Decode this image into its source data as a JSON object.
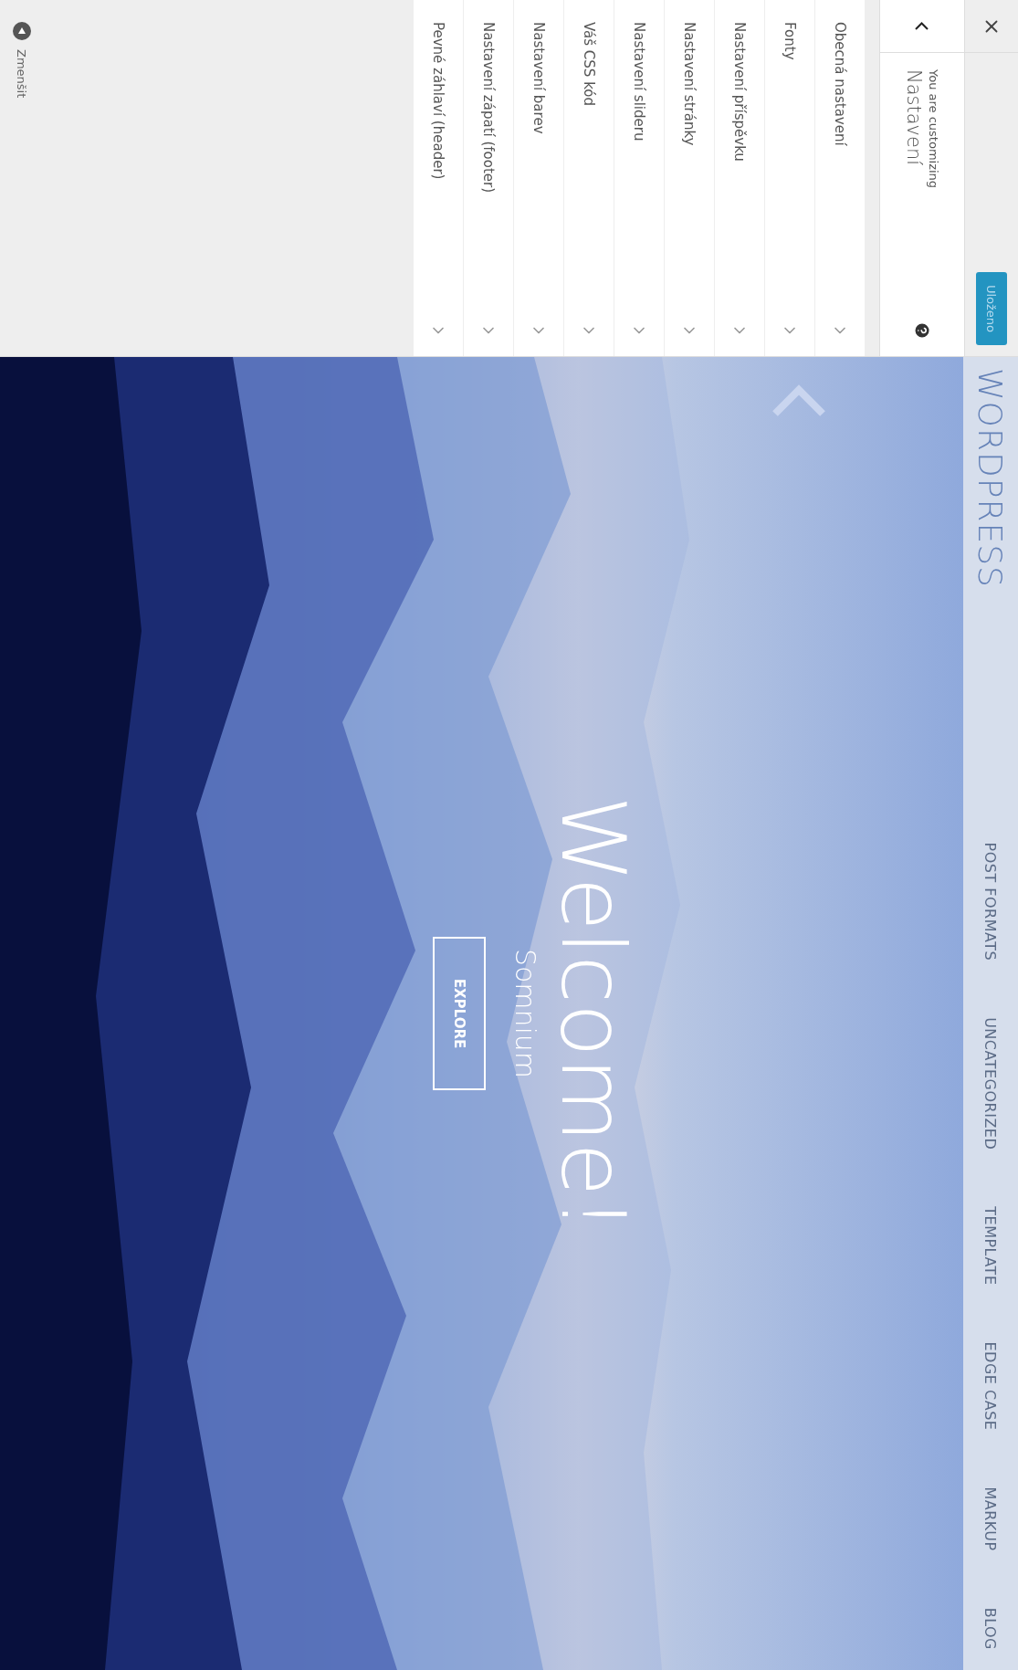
{
  "sidebar": {
    "save_button": {
      "label": "Uloženo",
      "disabled": true
    },
    "customizing_label": "You are customizing",
    "title": "Nastavení",
    "sections": [
      {
        "label": "Obecná nastavení"
      },
      {
        "label": "Fonty"
      },
      {
        "label": "Nastavení příspěvku"
      },
      {
        "label": "Nastavení stránky"
      },
      {
        "label": "Nastavení slideru"
      },
      {
        "label": "Váš CSS kód"
      },
      {
        "label": "Nastavení barev"
      },
      {
        "label": "Nastavení zápatí (footer)"
      },
      {
        "label": "Pevné záhlaví (header)"
      }
    ],
    "collapse_label": "Zmenšit"
  },
  "preview": {
    "logo": "WORDPRESS",
    "menu": [
      "POST FORMATS",
      "UNCATEGORIZED",
      "TEMPLATE",
      "EDGE CASE",
      "MARKUP",
      "BLOG"
    ],
    "hero": {
      "heading": "Welcome!",
      "subheading": "Somnium",
      "button": "EXPLORE"
    }
  }
}
